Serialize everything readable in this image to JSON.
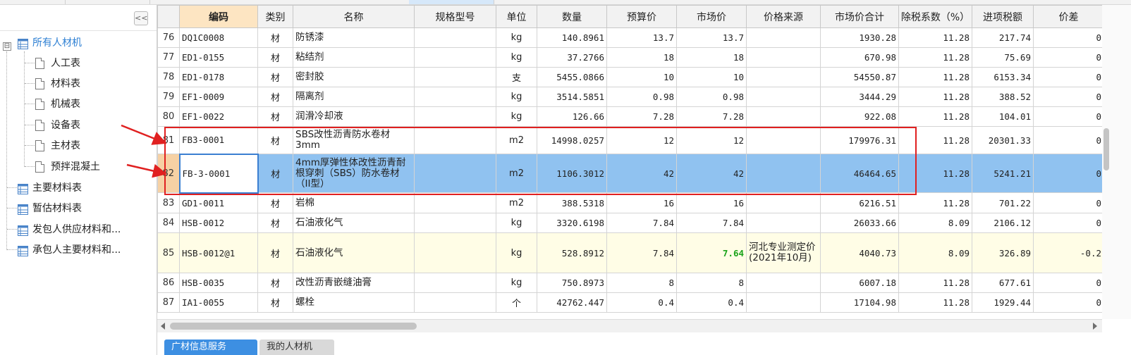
{
  "colors": {
    "accent": "#2d7fd3",
    "selected_row": "#90c2f0",
    "highlight_box": "#e02020",
    "yellow_row": "#fffde6",
    "green_price": "#1aa31a"
  },
  "sidebar": {
    "collapse_icon": "double-chevron-left-icon",
    "collapse_label": "<<",
    "root_toggle": "⊟",
    "root_label": "所有人材机",
    "children": [
      "人工表",
      "材料表",
      "机械表",
      "设备表",
      "主材表",
      "预拌混凝土"
    ],
    "groups": [
      "主要材料表",
      "暂估材料表",
      "发包人供应材料和...",
      "承包人主要材料和..."
    ]
  },
  "table": {
    "columns": [
      "",
      "编码",
      "类别",
      "名称",
      "规格型号",
      "单位",
      "数量",
      "预算价",
      "市场价",
      "价格来源",
      "市场价合计",
      "除税系数（%）",
      "进项税额",
      "价差"
    ],
    "rows": [
      {
        "no": "76",
        "code": "DQ1C0008",
        "type": "材",
        "name": "防锈漆",
        "spec": "",
        "unit": "kg",
        "qty": "140.8961",
        "budget": "13.7",
        "market": "13.7",
        "source": "",
        "total": "1930.28",
        "tax_rate": "11.28",
        "tax": "217.74",
        "diff": "0"
      },
      {
        "no": "77",
        "code": "ED1-0155",
        "type": "材",
        "name": "粘结剂",
        "spec": "",
        "unit": "kg",
        "qty": "37.2766",
        "budget": "18",
        "market": "18",
        "source": "",
        "total": "670.98",
        "tax_rate": "11.28",
        "tax": "75.69",
        "diff": "0"
      },
      {
        "no": "78",
        "code": "ED1-0178",
        "type": "材",
        "name": "密封胶",
        "spec": "",
        "unit": "支",
        "qty": "5455.0866",
        "budget": "10",
        "market": "10",
        "source": "",
        "total": "54550.87",
        "tax_rate": "11.28",
        "tax": "6153.34",
        "diff": "0"
      },
      {
        "no": "79",
        "code": "EF1-0009",
        "type": "材",
        "name": "隔离剂",
        "spec": "",
        "unit": "kg",
        "qty": "3514.5851",
        "budget": "0.98",
        "market": "0.98",
        "source": "",
        "total": "3444.29",
        "tax_rate": "11.28",
        "tax": "388.52",
        "diff": "0"
      },
      {
        "no": "80",
        "code": "EF1-0022",
        "type": "材",
        "name": "润滑冷却液",
        "spec": "",
        "unit": "kg",
        "qty": "126.66",
        "budget": "7.28",
        "market": "7.28",
        "source": "",
        "total": "922.08",
        "tax_rate": "11.28",
        "tax": "104.01",
        "diff": "0"
      },
      {
        "no": "81",
        "code": "FB3-0001",
        "type": "材",
        "name": "SBS改性沥青防水卷材3mm",
        "spec": "",
        "unit": "m2",
        "qty": "14998.0257",
        "budget": "12",
        "market": "12",
        "source": "",
        "total": "179976.31",
        "tax_rate": "11.28",
        "tax": "20301.33",
        "diff": "0"
      },
      {
        "no": "82",
        "code": "FB-3-0001",
        "type": "材",
        "name": "4mm厚弹性体改性沥青耐根穿刺（SBS）防水卷材（II型）",
        "spec": "",
        "unit": "m2",
        "qty": "1106.3012",
        "budget": "42",
        "market": "42",
        "source": "",
        "total": "46464.65",
        "tax_rate": "11.28",
        "tax": "5241.21",
        "diff": "0"
      },
      {
        "no": "83",
        "code": "GD1-0011",
        "type": "材",
        "name": "岩棉",
        "spec": "",
        "unit": "m2",
        "qty": "388.5318",
        "budget": "16",
        "market": "16",
        "source": "",
        "total": "6216.51",
        "tax_rate": "11.28",
        "tax": "701.22",
        "diff": "0"
      },
      {
        "no": "84",
        "code": "HSB-0012",
        "type": "材",
        "name": "石油液化气",
        "spec": "",
        "unit": "kg",
        "qty": "3320.6198",
        "budget": "7.84",
        "market": "7.84",
        "source": "",
        "total": "26033.66",
        "tax_rate": "8.09",
        "tax": "2106.12",
        "diff": "0"
      },
      {
        "no": "85",
        "code": "HSB-0012@1",
        "type": "材",
        "name": "石油液化气",
        "spec": "",
        "unit": "kg",
        "qty": "528.8912",
        "budget": "7.84",
        "market": "7.64",
        "source": "河北专业测定价(2021年10月)",
        "total": "4040.73",
        "tax_rate": "8.09",
        "tax": "326.89",
        "diff": "-0.2"
      },
      {
        "no": "86",
        "code": "HSB-0035",
        "type": "材",
        "name": "改性沥青嵌缝油膏",
        "spec": "",
        "unit": "kg",
        "qty": "750.8973",
        "budget": "8",
        "market": "8",
        "source": "",
        "total": "6007.18",
        "tax_rate": "11.28",
        "tax": "677.61",
        "diff": "0"
      },
      {
        "no": "87",
        "code": "IA1-0055",
        "type": "材",
        "name": "螺栓",
        "spec": "",
        "unit": "个",
        "qty": "42762.447",
        "budget": "0.4",
        "market": "0.4",
        "source": "",
        "total": "17104.98",
        "tax_rate": "11.28",
        "tax": "1929.44",
        "diff": "0"
      }
    ]
  },
  "bottom_tabs": [
    "广材信息服务",
    "我的人材机"
  ]
}
